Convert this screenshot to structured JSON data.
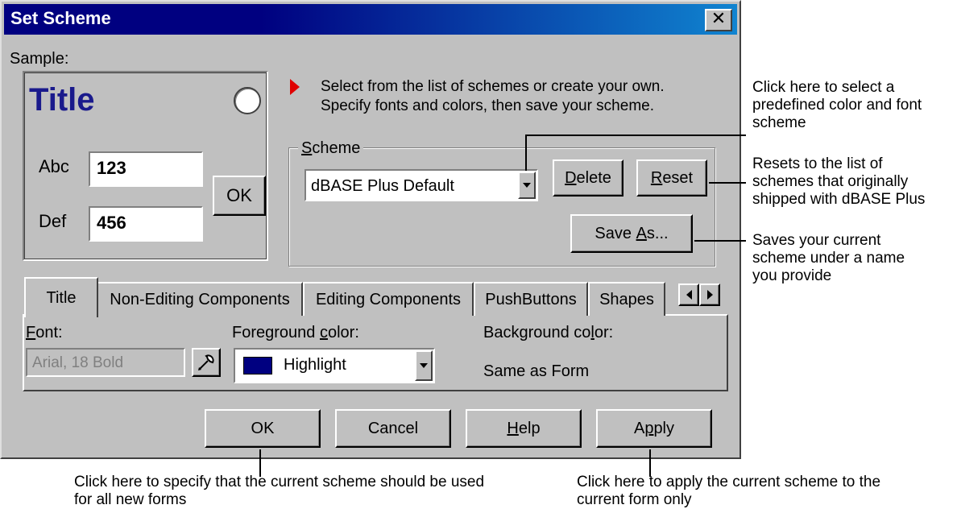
{
  "window": {
    "title": "Set Scheme",
    "close_glyph": "✕"
  },
  "sample": {
    "label": "Sample:",
    "title_text": "Title",
    "row1_label": "Abc",
    "row1_value": "123",
    "row2_label": "Def",
    "row2_value": "456",
    "ok_label": "OK"
  },
  "instructions": {
    "line1": "Select from the list of schemes or create your own.",
    "line2": "Specify fonts and colors, then save your scheme."
  },
  "scheme": {
    "group_label_prefix": "",
    "group_label_key": "S",
    "group_label_rest": "cheme",
    "selected": "dBASE Plus Default",
    "delete_key": "D",
    "delete_rest": "elete",
    "reset_key": "R",
    "reset_rest": "eset",
    "save_as_prefix": "Save ",
    "save_as_key": "A",
    "save_as_rest": "s..."
  },
  "tabs": [
    {
      "label": "Title"
    },
    {
      "label": "Non-Editing Components"
    },
    {
      "label": "Editing Components"
    },
    {
      "label": "PushButtons"
    },
    {
      "label": "Shapes"
    }
  ],
  "panel": {
    "font_key": "F",
    "font_rest": "ont:",
    "font_value": "Arial, 18 Bold",
    "fg_prefix": "Foreground ",
    "fg_key": "c",
    "fg_rest": "olor:",
    "fg_value": "Highlight",
    "fg_swatch": "#000080",
    "bg_prefix": "Background co",
    "bg_key": "l",
    "bg_rest": "or:",
    "bg_value": "Same as Form"
  },
  "buttons": {
    "ok": "OK",
    "cancel": "Cancel",
    "help_key": "H",
    "help_rest": "elp",
    "apply_prefix": "A",
    "apply_key": "p",
    "apply_rest": "ply"
  },
  "callouts": {
    "select": [
      "Click here to select a",
      "predefined color and font",
      "scheme"
    ],
    "reset": [
      "Resets to the list of",
      "schemes that originally",
      "shipped with dBASE Plus"
    ],
    "saveas": [
      "Saves your current",
      "scheme under a name",
      "you provide"
    ],
    "ok": [
      "Click here to specify that the current scheme should be used",
      "for all new forms"
    ],
    "apply": [
      "Click here to apply the current scheme to the",
      "current form only"
    ]
  },
  "colors": {
    "titlebar": "#000080",
    "face": "#c0c0c0",
    "arrow": "#e00000"
  }
}
